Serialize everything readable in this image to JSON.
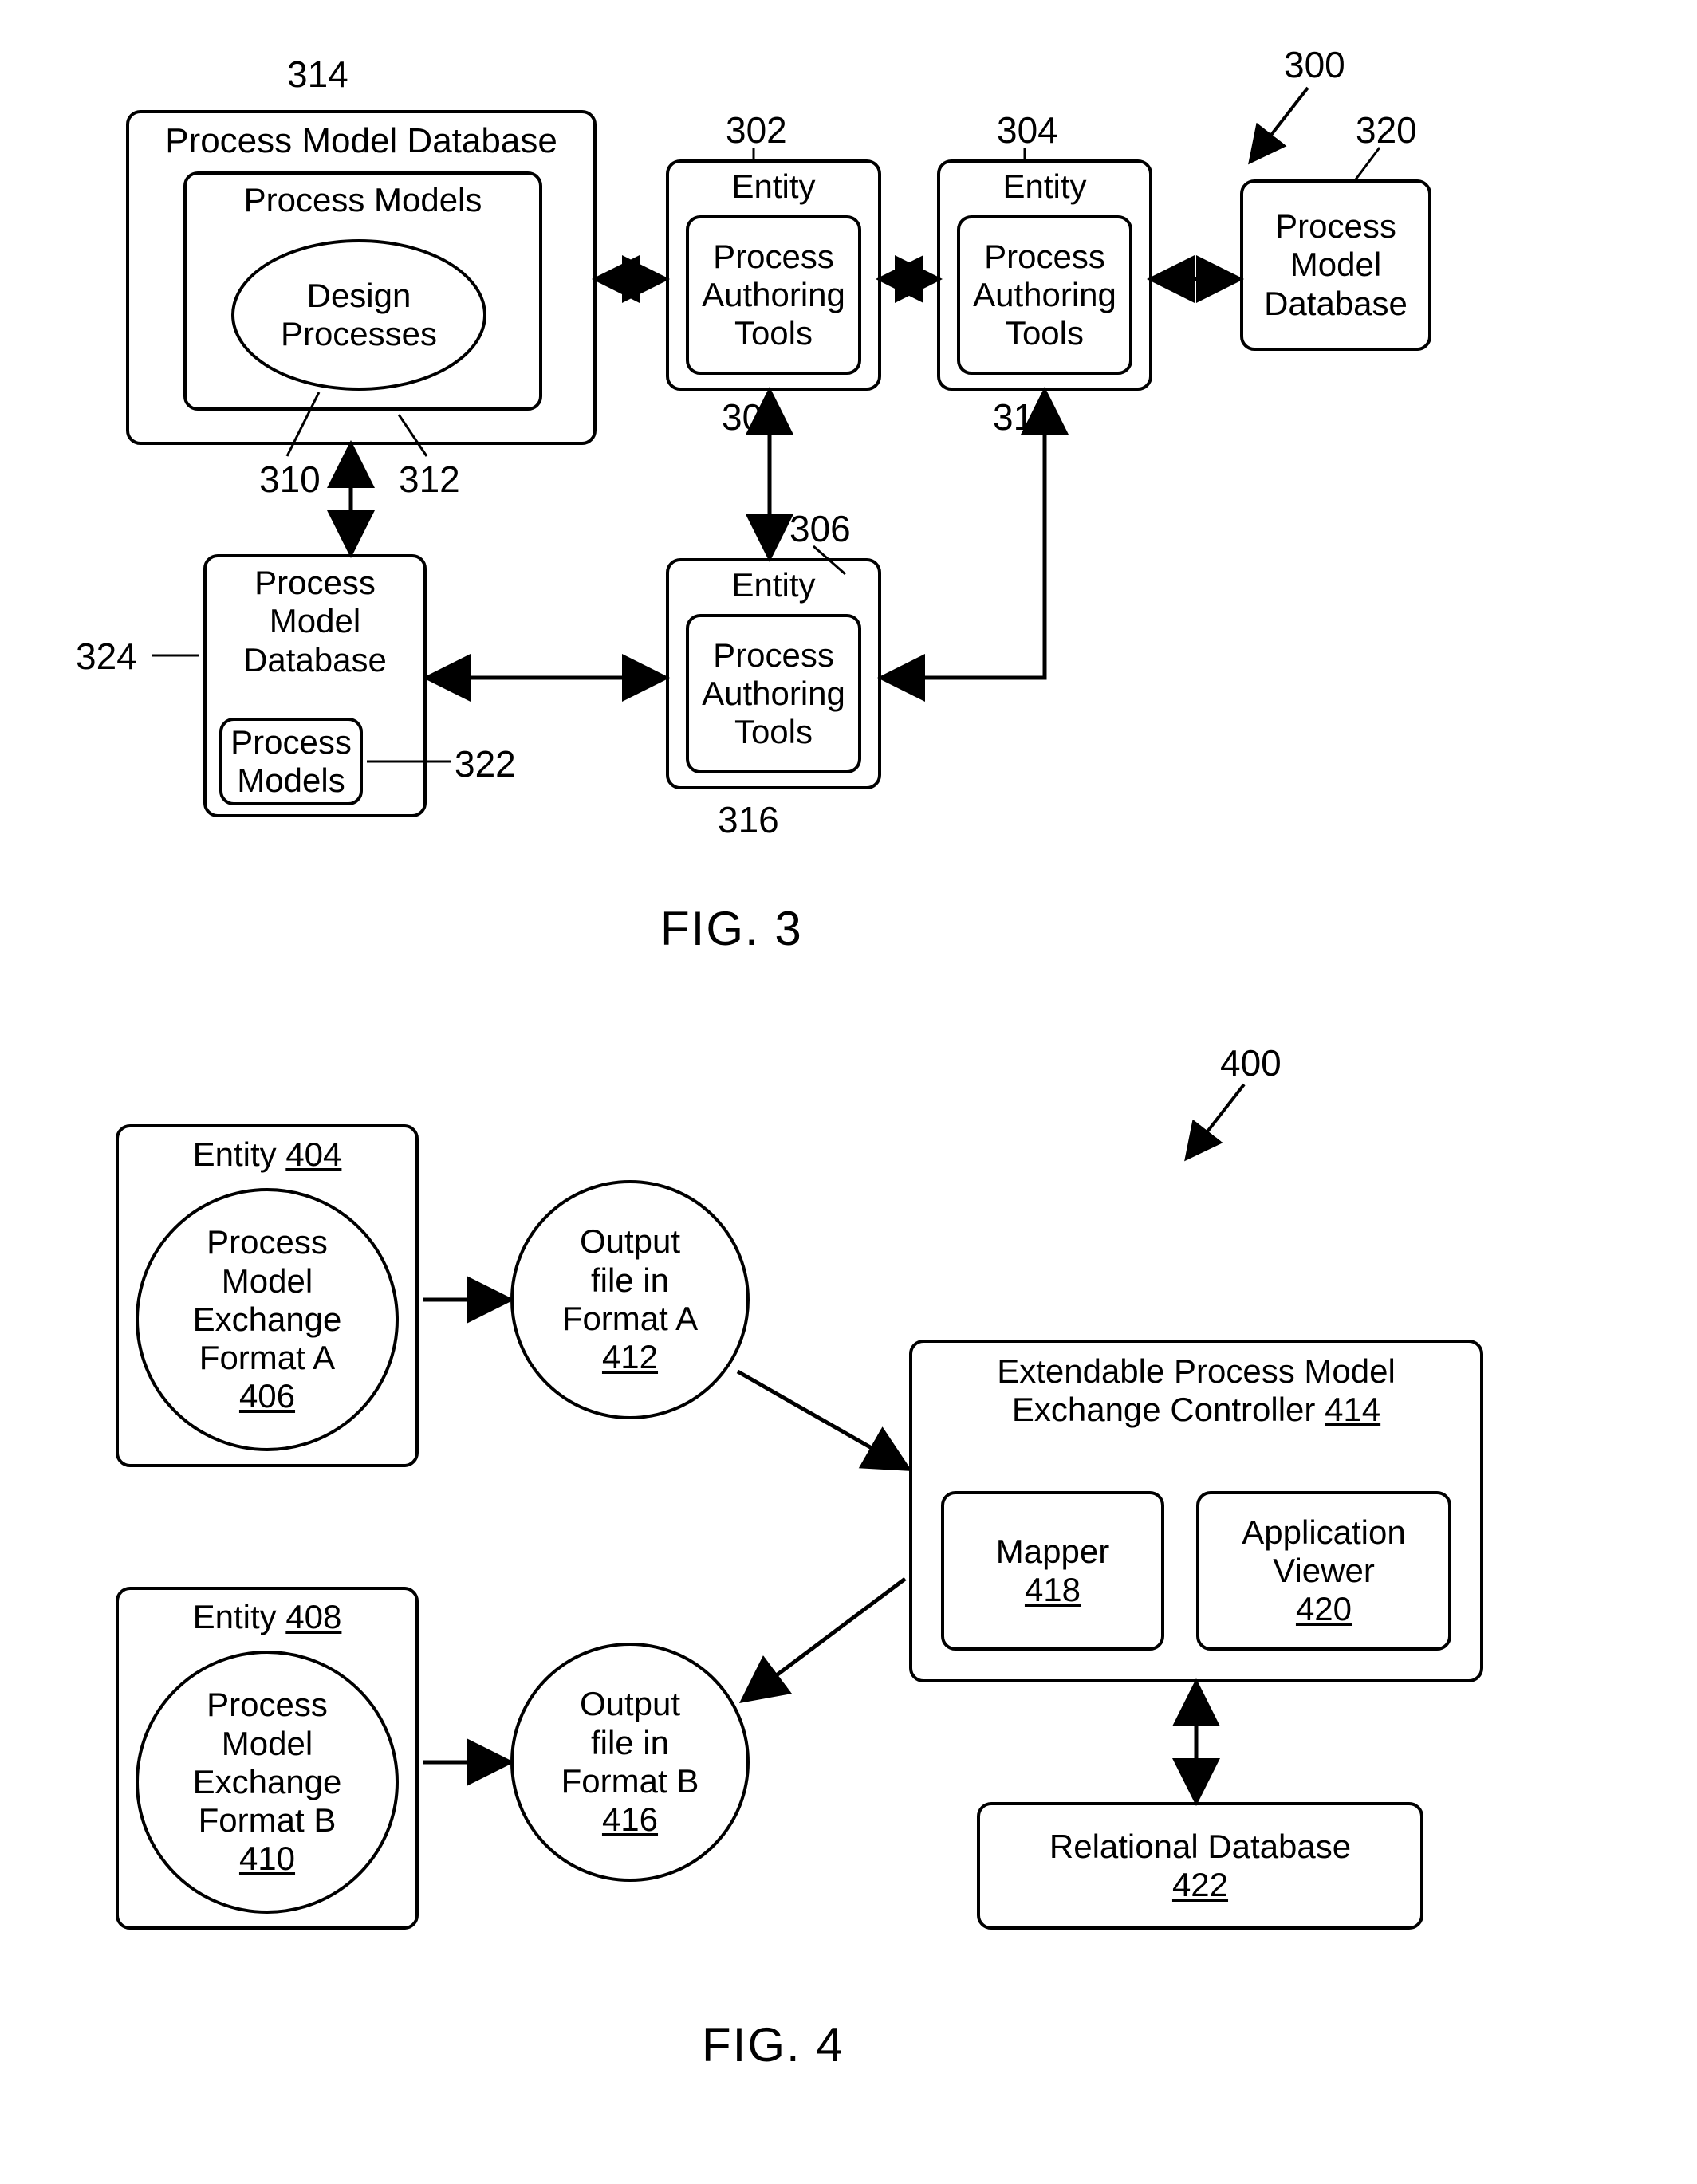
{
  "fig3": {
    "ref300": "300",
    "ref302": "302",
    "ref304": "304",
    "ref306": "306",
    "ref308": "308",
    "ref310": "310",
    "ref312": "312",
    "ref314": "314",
    "ref316": "316",
    "ref318": "318",
    "ref320": "320",
    "ref322": "322",
    "ref324": "324",
    "pmd": "Process Model Database",
    "pmdShort1": "Process\nModel\nDatabase",
    "pmdShort2": "Process\nModel\nDatabase",
    "processModels": "Process Models",
    "processModelsShort": "Process\nModels",
    "designProcesses": "Design\nProcesses",
    "entity": "Entity",
    "pat": "Process\nAuthoring\nTools",
    "caption": "FIG. 3"
  },
  "fig4": {
    "ref400": "400",
    "ref404": "404",
    "ref406": "406",
    "ref408": "408",
    "ref410": "410",
    "ref412": "412",
    "ref414": "414",
    "ref416": "416",
    "ref418": "418",
    "ref420": "420",
    "ref422": "422",
    "entity": "Entity",
    "pmefA": "Process\nModel\nExchange\nFormat A",
    "pmefB": "Process\nModel\nExchange\nFormat B",
    "outA": "Output\nfile in\nFormat A",
    "outB": "Output\nfile in\nFormat B",
    "epmec": "Extendable Process Model\nExchange Controller",
    "mapper": "Mapper",
    "appViewer": "Application\nViewer",
    "reldb": "Relational Database",
    "caption": "FIG. 4"
  }
}
